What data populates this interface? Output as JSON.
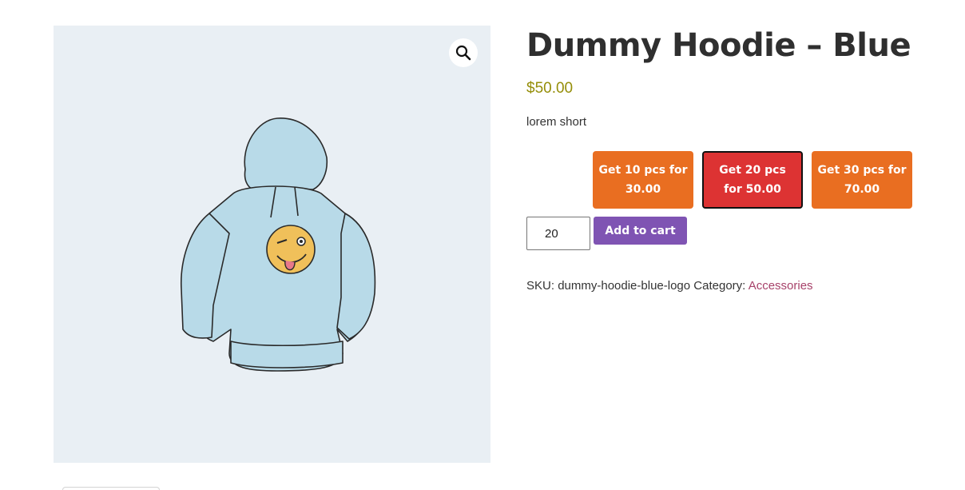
{
  "product": {
    "title": "Dummy Hoodie – Blue",
    "price": "$50.00",
    "short_description": "lorem short",
    "image_alt": "Blue hoodie with winking emoji",
    "zoom_icon": "magnifier-icon"
  },
  "offers": [
    {
      "label": "Get 10 pcs for 30.00",
      "selected": false
    },
    {
      "label": "Get 20 pcs for 50.00",
      "selected": true
    },
    {
      "label": "Get 30 pcs for 70.00",
      "selected": false
    }
  ],
  "cart": {
    "quantity": "20",
    "add_to_cart_label": "Add to cart"
  },
  "meta": {
    "sku_label": "SKU:",
    "sku_value": "dummy-hoodie-blue-logo",
    "category_label": "Category:",
    "category_value": "Accessories"
  },
  "colors": {
    "offer": "#e96e21",
    "offer_selected": "#dd3333",
    "button": "#7f54b3",
    "price": "#958e09",
    "link": "#a7426a"
  }
}
